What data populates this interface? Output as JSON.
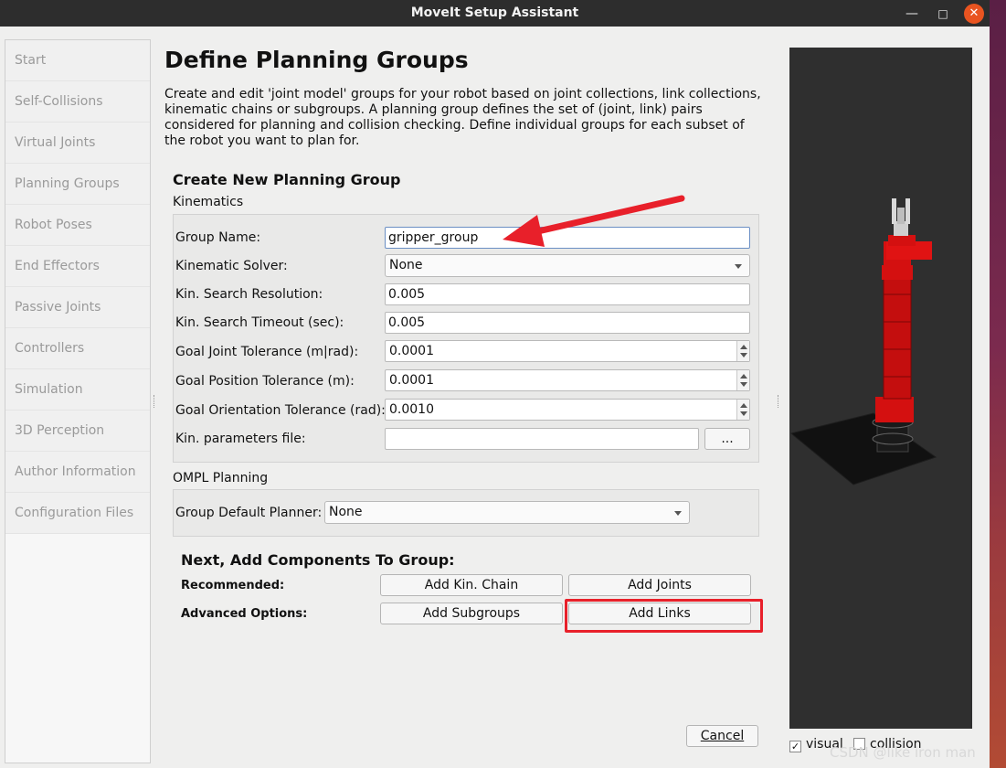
{
  "window": {
    "title": "MoveIt Setup Assistant",
    "minimize_glyph": "—",
    "maximize_glyph": "□",
    "close_glyph": "✕"
  },
  "sidebar": {
    "items": [
      {
        "label": "Start"
      },
      {
        "label": "Self-Collisions"
      },
      {
        "label": "Virtual Joints"
      },
      {
        "label": "Planning Groups"
      },
      {
        "label": "Robot Poses"
      },
      {
        "label": "End Effectors"
      },
      {
        "label": "Passive Joints"
      },
      {
        "label": "Controllers"
      },
      {
        "label": "Simulation"
      },
      {
        "label": "3D Perception"
      },
      {
        "label": "Author Information"
      },
      {
        "label": "Configuration Files"
      }
    ]
  },
  "page": {
    "title": "Define Planning Groups",
    "description": "Create and edit 'joint model' groups for your robot based on joint collections, link collections, kinematic chains or subgroups. A planning group defines the set of (joint, link) pairs considered for planning and collision checking. Define individual groups for each subset of the robot you want to plan for."
  },
  "create_group": {
    "title": "Create New Planning Group",
    "kinematics_label": "Kinematics",
    "fields": {
      "group_name": {
        "label": "Group Name:",
        "value": "gripper_group"
      },
      "kinematic_solver": {
        "label": "Kinematic Solver:",
        "value": "None"
      },
      "search_resolution": {
        "label": "Kin. Search Resolution:",
        "value": "0.005"
      },
      "search_timeout": {
        "label": "Kin. Search Timeout (sec):",
        "value": "0.005"
      },
      "goal_joint_tol": {
        "label": "Goal Joint Tolerance (m|rad):",
        "value": "0.0001"
      },
      "goal_position_tol": {
        "label": "Goal Position Tolerance (m):",
        "value": "0.0001"
      },
      "goal_orientation_tol": {
        "label": "Goal Orientation Tolerance (rad):",
        "value": "0.0010"
      },
      "params_file": {
        "label": "Kin. parameters file:",
        "value": "",
        "browse_label": "..."
      }
    },
    "ompl_label": "OMPL Planning",
    "default_planner": {
      "label": "Group Default Planner:",
      "value": "None"
    }
  },
  "components": {
    "title": "Next, Add Components To Group:",
    "recommended_label": "Recommended:",
    "advanced_label": "Advanced Options:",
    "add_kin_chain": "Add Kin. Chain",
    "add_joints": "Add Joints",
    "add_subgroups": "Add Subgroups",
    "add_links": "Add Links"
  },
  "footer": {
    "cancel_label": "Cancel"
  },
  "viewer": {
    "visual_label": "visual",
    "visual_checked": true,
    "collision_label": "collision",
    "collision_checked": false
  },
  "watermark": "CSDN @like iron man",
  "colors": {
    "robot_red": "#d41010",
    "annotation_red": "#e8202a",
    "viewport_bg": "#2f2f2f"
  }
}
